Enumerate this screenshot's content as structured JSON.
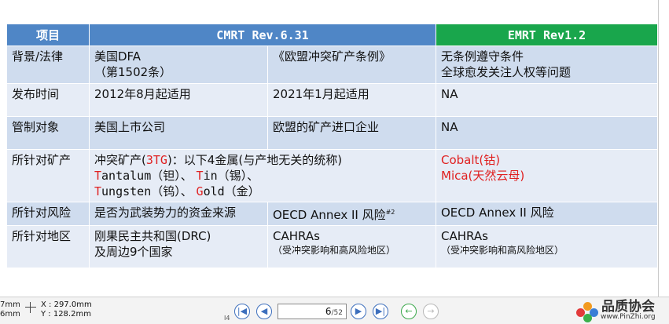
{
  "table": {
    "headers": [
      "项目",
      "CMRT Rev.6.31",
      "EMRT  Rev1.2"
    ],
    "rows": [
      {
        "label": "背景/法律",
        "cmrt_a": [
          "美国DFA",
          "（第1502条）"
        ],
        "cmrt_b": "《欧盟冲突矿产条例》",
        "emrt": [
          "无条例遵守条件",
          "全球愈发关注人权等问题"
        ]
      },
      {
        "label": "发布时间",
        "cmrt_a": [
          "2012年8月起适用"
        ],
        "cmrt_b": "2021年1月起适用",
        "emrt": [
          "NA"
        ]
      },
      {
        "label": "管制对象",
        "cmrt_a": [
          "美国上市公司"
        ],
        "cmrt_b": "欧盟的矿产进口企业",
        "emrt": [
          "NA"
        ]
      },
      {
        "label": "所针对矿产",
        "minerals_intro_1": "冲突矿产(",
        "minerals_intro_3tg": "3TG",
        "minerals_intro_2": ")：以下4金属(与产地无关的统称)",
        "minerals_line2": [
          {
            "initial": "T",
            "rest": "antalum",
            "cn": "（钽）、 "
          },
          {
            "initial": "T",
            "rest": "in",
            "cn": "（锡）、"
          }
        ],
        "minerals_line3": [
          {
            "initial": "T",
            "rest": "ungsten",
            "cn": "（钨）、 "
          },
          {
            "initial": "G",
            "rest": "old",
            "cn": "（金）"
          }
        ],
        "emrt": [
          "Cobalt(钴)",
          "Mica(天然云母)"
        ]
      },
      {
        "label": "所针对风险",
        "cmrt_a": [
          "是否为武装势力的资金来源"
        ],
        "cmrt_b": "OECD Annex II 风险",
        "cmrt_b_sup": "#2",
        "emrt": [
          "OECD Annex II 风险"
        ]
      },
      {
        "label": "所针对地区",
        "cmrt_a": [
          "刚果民主共和国(DRC)",
          "及周边9个国家"
        ],
        "cmrt_b": "CAHRAs",
        "cmrt_b_note": "（受冲突影响和高风险地区）",
        "emrt": [
          "CAHRAs"
        ],
        "emrt_note": "（受冲突影响和高风险地区）"
      }
    ]
  },
  "toolbar": {
    "unit_top": "7mm",
    "unit_bottom": "6mm",
    "x_readout": "X : 297.0mm",
    "y_readout": "Y : 128.2mm",
    "page_current": "6",
    "page_total": "/52",
    "pi_mark": "I4"
  },
  "logo": {
    "title": "品质协会",
    "url": "www.PinZhi.org"
  },
  "colors": {
    "header_blue": "#4f86c6",
    "header_green": "#19a64c",
    "row_dark": "#cfdcee",
    "row_light": "#e6ecf6",
    "accent_red": "#e02020"
  }
}
